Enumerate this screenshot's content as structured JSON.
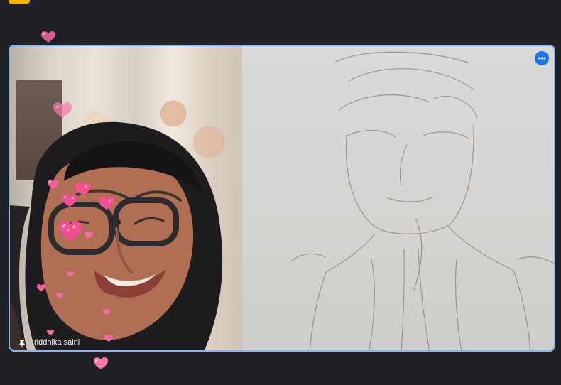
{
  "participant": {
    "name": "riddhika saini"
  },
  "icons": {
    "more": "more-options-icon",
    "pin": "pin-icon",
    "heart": "heart-reaction-icon"
  },
  "colors": {
    "background": "#202124",
    "tile_border": "#8ab4f8",
    "more_button": "#1a73e8",
    "top_chip": "#f5b400",
    "heart": "#e85b97"
  }
}
